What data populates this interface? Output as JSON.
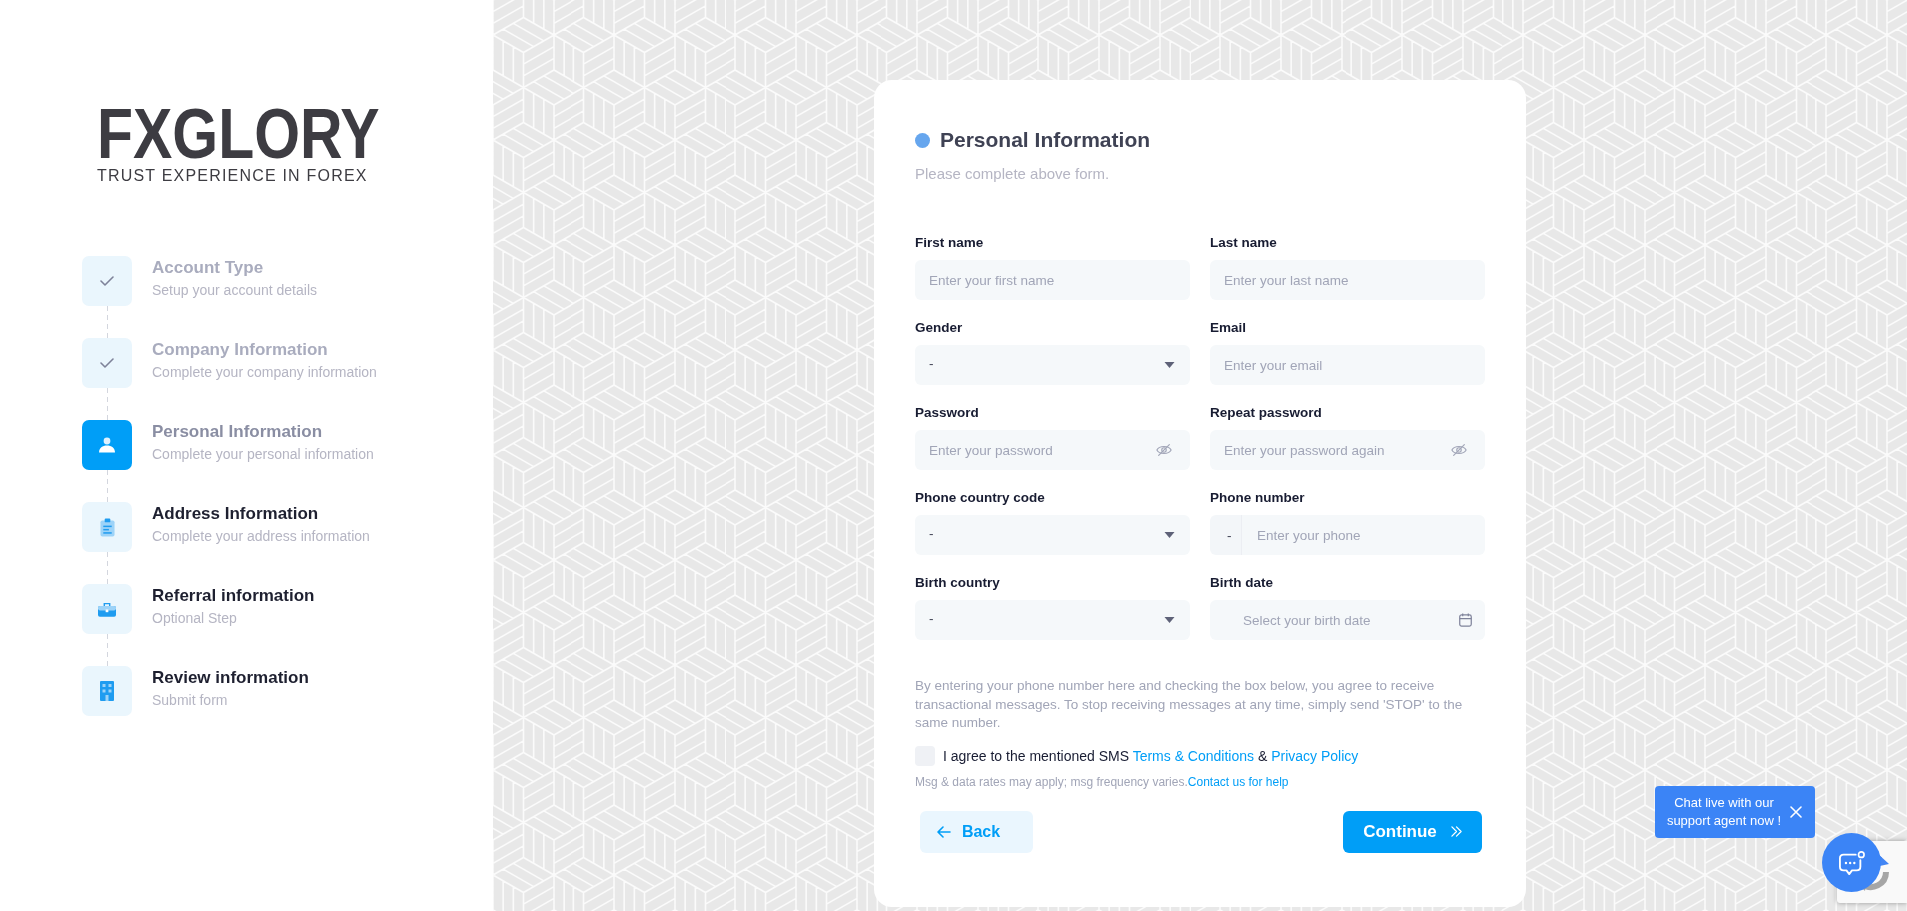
{
  "logo": {
    "wordmark": "FXGLORY",
    "tagline": "TRUST EXPERIENCE IN FOREX"
  },
  "steps": [
    {
      "title": "Account Type",
      "subtitle": "Setup your account details",
      "completed": true,
      "selected": false
    },
    {
      "title": "Company Information",
      "subtitle": "Complete your company information",
      "completed": true,
      "selected": false
    },
    {
      "title": "Personal Information",
      "subtitle": "Complete your personal information",
      "completed": false,
      "selected": true
    },
    {
      "title": "Address Information",
      "subtitle": "Complete your address information",
      "completed": false,
      "selected": false
    },
    {
      "title": "Referral information",
      "subtitle": "Optional Step",
      "completed": false,
      "selected": false
    },
    {
      "title": "Review information",
      "subtitle": "Submit form",
      "completed": false,
      "selected": false
    }
  ],
  "form": {
    "title": "Personal Information",
    "subtitle": "Please complete above form.",
    "fields": [
      {
        "kind": "text",
        "label": "First name",
        "placeholder": "Enter your first name"
      },
      {
        "kind": "text",
        "label": "Last name",
        "placeholder": "Enter your last name"
      },
      {
        "kind": "select",
        "label": "Gender",
        "value": "-"
      },
      {
        "kind": "email",
        "label": "Email",
        "placeholder": "Enter your email"
      },
      {
        "kind": "password",
        "label": "Password",
        "placeholder": "Enter your password"
      },
      {
        "kind": "password",
        "label": "Repeat password",
        "placeholder": "Enter your password again"
      },
      {
        "kind": "select",
        "label": "Phone country code",
        "value": "-"
      },
      {
        "kind": "phone",
        "label": "Phone number",
        "prefix": "-",
        "placeholder": "Enter your phone"
      },
      {
        "kind": "select",
        "label": "Birth country",
        "value": "-"
      },
      {
        "kind": "date",
        "label": "Birth date",
        "placeholder": "Select your birth date"
      }
    ],
    "notice": "By entering your phone number here and checking the box below, you agree to receive transactional messages. To stop receiving messages at any time, simply send 'STOP' to the same number.",
    "consent": {
      "checked": false,
      "text": "I agree to the mentioned SMS",
      "terms_link": "Terms & Conditions",
      "joiner": "&",
      "privacy_link": "Privacy Policy"
    },
    "fine_print": {
      "text": "Msg & data rates may apply; msg frequency varies.",
      "link": "Contact us for help"
    },
    "back_button": "Back",
    "continue_button": "Continue"
  },
  "chat": {
    "prompt": "Chat live with our support agent now !"
  }
}
